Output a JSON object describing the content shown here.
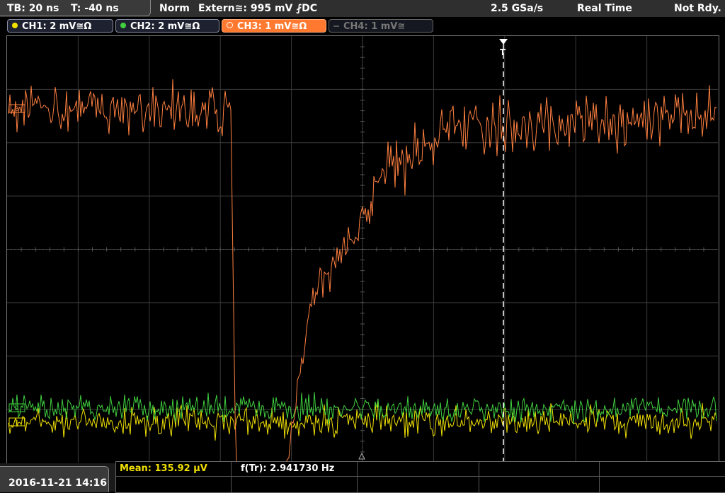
{
  "topbar": {
    "timebase": "TB: 20 ns",
    "trigger_offset": "T: -40 ns",
    "trigger_mode": "Norm",
    "trigger_source": "Extern≅: 995 mV ⨏DC",
    "sample_rate": "2.5 GSa/s",
    "acq_mode": "Real Time",
    "status": "Not Rdy."
  },
  "channels": [
    {
      "label": "CH1: 2 mV≅Ω",
      "color": "#f0e000",
      "active": false
    },
    {
      "label": "CH2: 2 mV≅Ω",
      "color": "#40d040",
      "active": false
    },
    {
      "label": "CH3: 1 mV≅Ω",
      "color": "#ff8040",
      "active": true
    },
    {
      "label": "CH4: 1 mV≅",
      "color": "#888888",
      "active": false,
      "disabled": true
    }
  ],
  "markers": {
    "trigger": "T",
    "ch3": "3",
    "ch2": "2",
    "ch1": "1"
  },
  "measurements": {
    "mean_label": "Mean: 135.92 µV",
    "freq_label": "f(Tr): 2.941730 Hz"
  },
  "footer": {
    "datetime": "2016-11-21 14:16"
  },
  "colors": {
    "ch1": "#f0e000",
    "ch2": "#40d040",
    "ch3": "#ff8040",
    "grid": "#3a3a3a"
  }
}
